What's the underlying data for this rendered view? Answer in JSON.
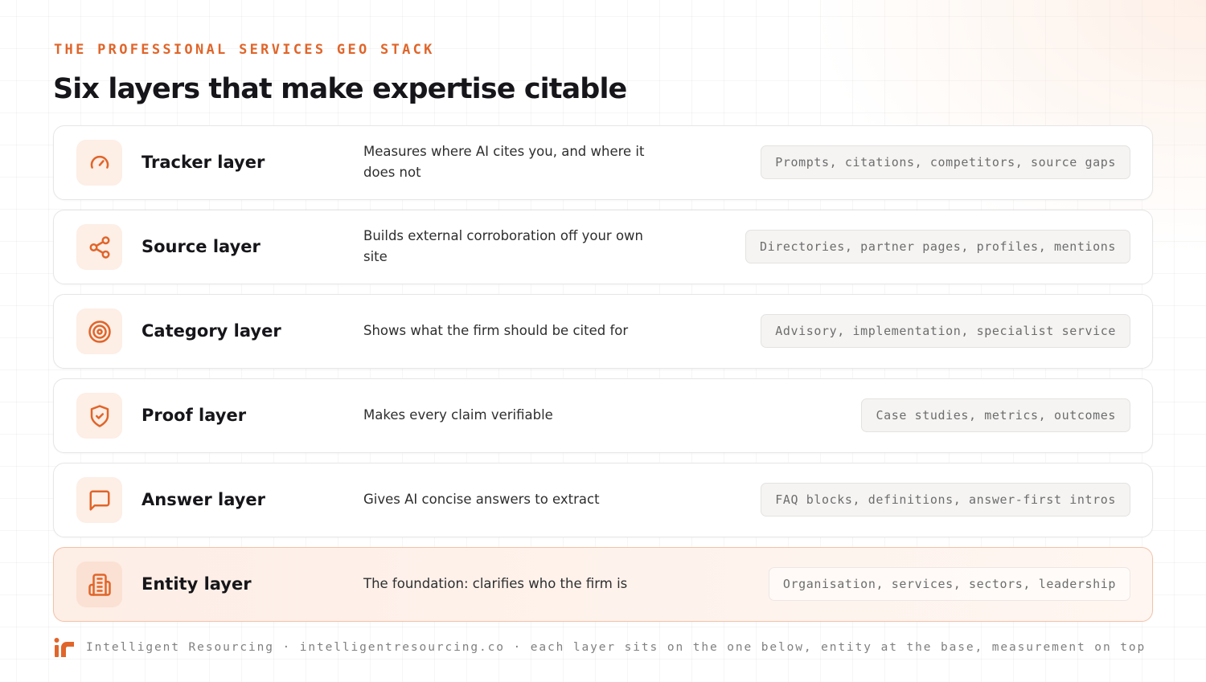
{
  "header": {
    "eyebrow": "THE PROFESSIONAL SERVICES GEO STACK",
    "title": "Six layers that make expertise citable"
  },
  "accent_color": "#e0652a",
  "layers": [
    {
      "icon": "gauge-icon",
      "name": "Tracker layer",
      "description": "Measures where AI cites you, and where it does not",
      "tags": "Prompts, citations, competitors, source gaps"
    },
    {
      "icon": "share-icon",
      "name": "Source layer",
      "description": "Builds external corroboration off your own site",
      "tags": "Directories, partner pages, profiles, mentions"
    },
    {
      "icon": "target-icon",
      "name": "Category layer",
      "description": "Shows what the firm should be cited for",
      "tags": "Advisory, implementation, specialist service"
    },
    {
      "icon": "shield-check-icon",
      "name": "Proof layer",
      "description": "Makes every claim verifiable",
      "tags": "Case studies, metrics, outcomes"
    },
    {
      "icon": "message-square-icon",
      "name": "Answer layer",
      "description": "Gives AI concise answers to extract",
      "tags": "FAQ blocks, definitions, answer-first intros"
    },
    {
      "icon": "building-icon",
      "name": "Entity layer",
      "description": "The foundation: clarifies who the firm is",
      "tags": "Organisation, services, sectors, leadership",
      "highlighted": true
    }
  ],
  "footer": {
    "logo": "intelligent-resourcing-logo",
    "text": "Intelligent Resourcing · intelligentresourcing.co · each layer sits on the one below, entity at the base, measurement on top"
  }
}
